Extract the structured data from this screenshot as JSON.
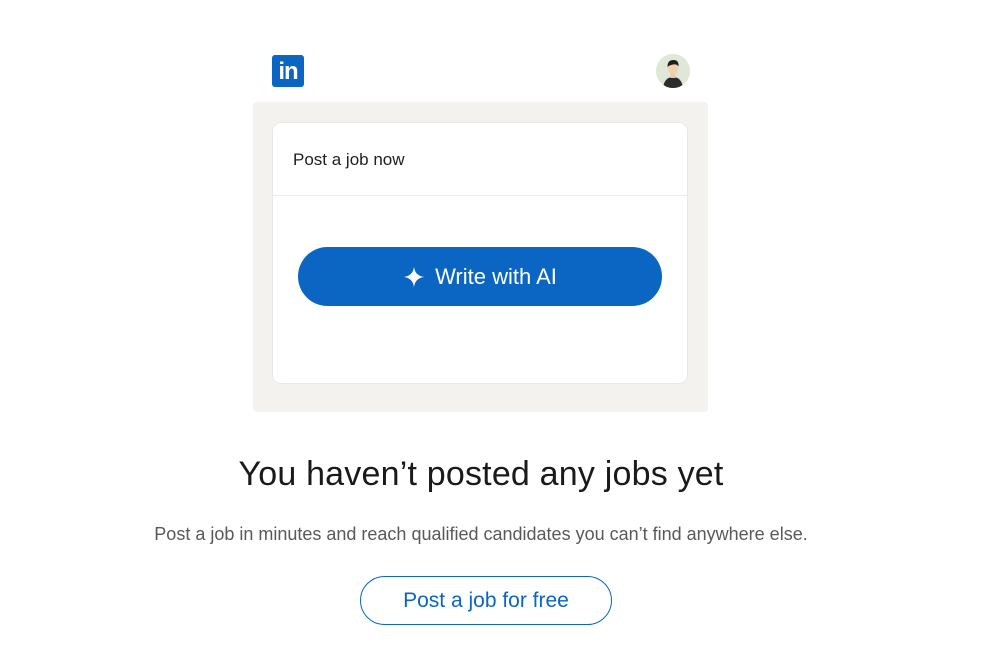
{
  "illustration": {
    "logo_text": "in",
    "card_title": "Post a job now",
    "ai_button_label": "Write with AI",
    "ai_icon": "sparkle-icon",
    "avatar_icon": "user-avatar"
  },
  "empty_state": {
    "headline": "You haven’t posted any jobs yet",
    "description": "Post a job in minutes and reach qualified candidates you can’t find anywhere else.",
    "cta_label": "Post a job for free"
  },
  "colors": {
    "brand_blue": "#0a66c2",
    "frame_gray": "#f3f2ef",
    "heading_text": "#1a1a1a",
    "body_text": "#595959"
  }
}
